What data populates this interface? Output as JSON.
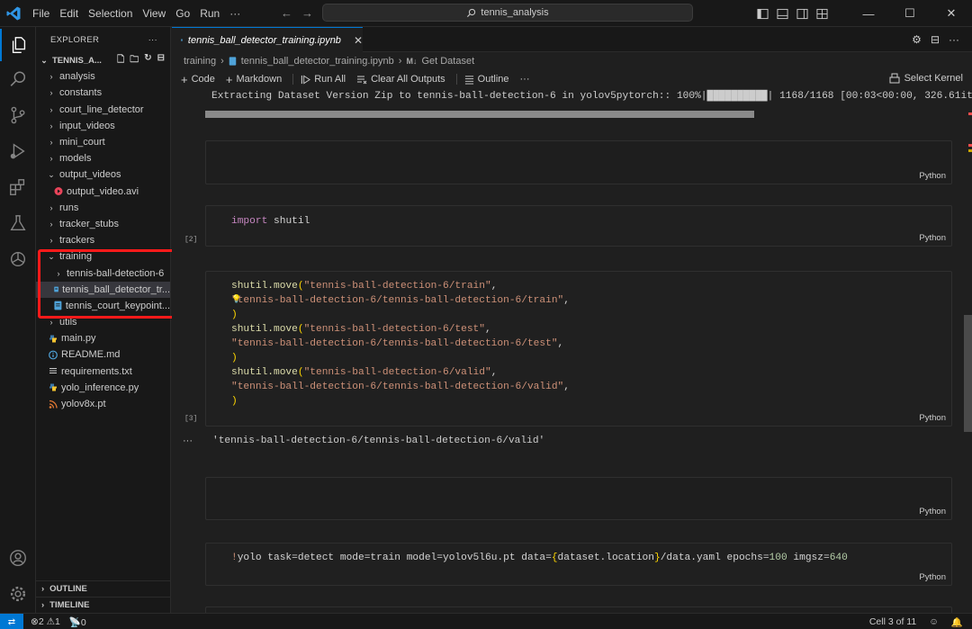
{
  "titlebar": {
    "menus": [
      "File",
      "Edit",
      "Selection",
      "View",
      "Go",
      "Run",
      "···"
    ],
    "search_text": "tennis_analysis"
  },
  "explorer": {
    "header": "EXPLORER",
    "root_label": "TENNIS_A...",
    "items": [
      {
        "label": "analysis",
        "type": "folder",
        "open": false,
        "depth": 1
      },
      {
        "label": "constants",
        "type": "folder",
        "open": false,
        "depth": 1
      },
      {
        "label": "court_line_detector",
        "type": "folder",
        "open": false,
        "depth": 1
      },
      {
        "label": "input_videos",
        "type": "folder",
        "open": false,
        "depth": 1
      },
      {
        "label": "mini_court",
        "type": "folder",
        "open": false,
        "depth": 1
      },
      {
        "label": "models",
        "type": "folder",
        "open": false,
        "depth": 1
      },
      {
        "label": "output_videos",
        "type": "folder",
        "open": true,
        "depth": 1
      },
      {
        "label": "output_video.avi",
        "type": "video",
        "depth": 2
      },
      {
        "label": "runs",
        "type": "folder",
        "open": false,
        "depth": 1
      },
      {
        "label": "tracker_stubs",
        "type": "folder",
        "open": false,
        "depth": 1
      },
      {
        "label": "trackers",
        "type": "folder",
        "open": false,
        "depth": 1
      },
      {
        "label": "training",
        "type": "folder",
        "open": true,
        "depth": 1
      },
      {
        "label": "tennis-ball-detection-6",
        "type": "folder",
        "open": false,
        "depth": 2
      },
      {
        "label": "tennis_ball_detector_tr...",
        "type": "notebook",
        "depth": 2,
        "selected": true
      },
      {
        "label": "tennis_court_keypoint...",
        "type": "notebook",
        "depth": 2
      },
      {
        "label": "utils",
        "type": "folder",
        "open": false,
        "depth": 1
      },
      {
        "label": "main.py",
        "type": "python",
        "depth": 1
      },
      {
        "label": "README.md",
        "type": "info",
        "depth": 1
      },
      {
        "label": "requirements.txt",
        "type": "text",
        "depth": 1
      },
      {
        "label": "yolo_inference.py",
        "type": "python",
        "depth": 1
      },
      {
        "label": "yolov8x.pt",
        "type": "rss",
        "depth": 1
      }
    ],
    "outline_label": "OUTLINE",
    "timeline_label": "TIMELINE"
  },
  "tab": {
    "label": "tennis_ball_detector_training.ipynb"
  },
  "breadcrumb": {
    "folder": "training",
    "file": "tennis_ball_detector_training.ipynb",
    "section_prefix": "M↓",
    "section": "Get Dataset"
  },
  "toolbar": {
    "code": "Code",
    "markdown": "Markdown",
    "run_all": "Run All",
    "clear_outputs": "Clear All Outputs",
    "outline": "Outline",
    "more": "···",
    "select_kernel": "Select Kernel"
  },
  "notebook": {
    "progress_output": "Extracting Dataset Version Zip to tennis-ball-detection-6 in yolov5pytorch:: 100%|██████████| 1168/1168 [00:03<00:00, 326.61it/s]",
    "progress_value": 1.0,
    "lang_label": "Python",
    "cell2": {
      "exec": "[2]",
      "kw": "import",
      "mod": "shutil"
    },
    "cell3": {
      "exec": "[3]",
      "fn": "shutil.move",
      "src_train": "\"tennis-ball-detection-6/train\"",
      "dst_train": "\"tennis-ball-detection-6/tennis-ball-detection-6/train\"",
      "src_test": "\"tennis-ball-detection-6/test\"",
      "dst_test": "\"tennis-ball-detection-6/tennis-ball-detection-6/test\"",
      "src_valid": "\"tennis-ball-detection-6/valid\"",
      "dst_valid": "\"tennis-ball-detection-6/tennis-ball-detection-6/valid\""
    },
    "output_ellipsis": "···",
    "output3": "'tennis-ball-detection-6/tennis-ball-detection-6/valid'",
    "cell5": {
      "bang": "!",
      "cmd": "yolo task=detect mode=train model=yolov5l6u.pt data=",
      "brace_open": "{",
      "expr": "dataset.location",
      "brace_close": "}",
      "path": "/data.yaml epochs=",
      "epochs": "100",
      "imgsz_label": " imgsz=",
      "imgsz": "640"
    }
  },
  "statusbar": {
    "errors": "2",
    "warnings": "1",
    "ports": "0",
    "cell_position": "Cell 3 of 11"
  },
  "colors": {
    "accent": "#0078d4",
    "highlight_box": "#ff1a1a"
  }
}
